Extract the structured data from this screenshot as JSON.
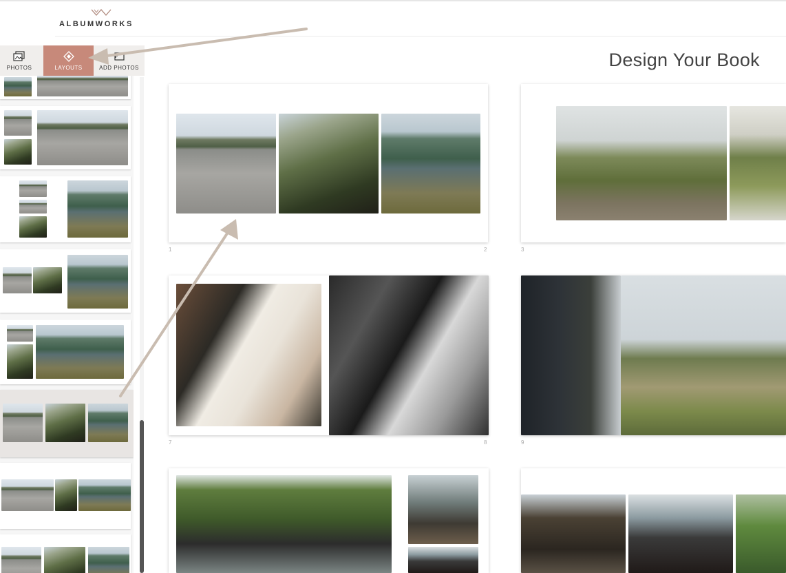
{
  "brand": {
    "name": "ALBUMWORKS",
    "logo_icon": "double-chevron-mark"
  },
  "header": {
    "title": "Design Your Book"
  },
  "sidebar": {
    "tabs": [
      {
        "label": "PHOTOS",
        "icon": "photos-icon",
        "active": false
      },
      {
        "label": "LAYOUTS",
        "icon": "layouts-icon",
        "active": true
      },
      {
        "label": "ADD PHOTOS",
        "icon": "add-photos-icon",
        "active": false
      }
    ],
    "selected_layout_index": 5,
    "layout_thumb_count": 8
  },
  "spreads": [
    {
      "left_page": "1",
      "right_page": "2"
    },
    {
      "left_page": "3",
      "right_page": ""
    },
    {
      "left_page": "7",
      "right_page": "8"
    },
    {
      "left_page": "9",
      "right_page": ""
    },
    {
      "left_page": "",
      "right_page": ""
    },
    {
      "left_page": "",
      "right_page": ""
    }
  ],
  "colors": {
    "accent": "#c7897a",
    "arrow": "#c9bcb0"
  }
}
